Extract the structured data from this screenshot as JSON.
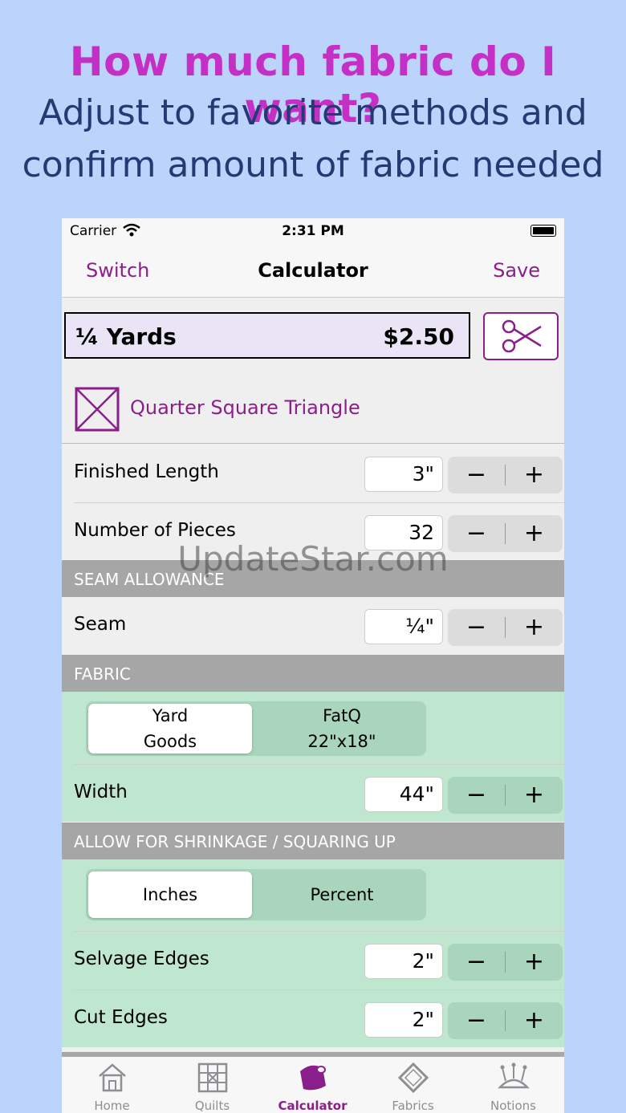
{
  "promo": {
    "title": "How much fabric do I want?",
    "subtitle_line1": "Adjust to favorite methods and",
    "subtitle_line2": "confirm amount of fabric needed"
  },
  "status_bar": {
    "carrier": "Carrier",
    "time": "2:31 PM"
  },
  "nav": {
    "left": "Switch",
    "title": "Calculator",
    "right": "Save"
  },
  "result": {
    "quantity": "¼ Yards",
    "price": "$2.50"
  },
  "block": {
    "name": "Quarter Square Triangle"
  },
  "rows": {
    "finished_length": {
      "label": "Finished Length",
      "value": "3\""
    },
    "number_of_pieces": {
      "label": "Number of Pieces",
      "value": "32"
    },
    "seam": {
      "label": "Seam",
      "value": "¼\""
    },
    "width": {
      "label": "Width",
      "value": "44\""
    },
    "selvage_edges": {
      "label": "Selvage Edges",
      "value": "2\""
    },
    "cut_edges": {
      "label": "Cut Edges",
      "value": "2\""
    }
  },
  "sections": {
    "seam_allowance": "SEAM ALLOWANCE",
    "fabric": "FABRIC",
    "shrinkage": "ALLOW FOR SHRINKAGE / SQUARING UP"
  },
  "fabric_segment": {
    "option1_line1": "Yard",
    "option1_line2": "Goods",
    "option2_line1": "FatQ",
    "option2_line2": "22\"x18\"",
    "selected": "Yard Goods"
  },
  "shrink_segment": {
    "option1": "Inches",
    "option2": "Percent",
    "selected": "Inches"
  },
  "stepper": {
    "minus": "−",
    "plus": "+"
  },
  "watermark": "UpdateStar.com",
  "tabs": [
    {
      "label": "Home",
      "icon": "home-icon"
    },
    {
      "label": "Quilts",
      "icon": "quilt-block-icon"
    },
    {
      "label": "Calculator",
      "icon": "fabric-bolt-icon",
      "active": true
    },
    {
      "label": "Fabrics",
      "icon": "fabric-diamond-icon"
    },
    {
      "label": "Notions",
      "icon": "pincushion-icon"
    }
  ],
  "colors": {
    "accent": "#8a1f8c",
    "promo_title": "#c42fc6",
    "promo_sub": "#233a73",
    "background": "#bcd3fb",
    "green": "#bfe6cf"
  }
}
